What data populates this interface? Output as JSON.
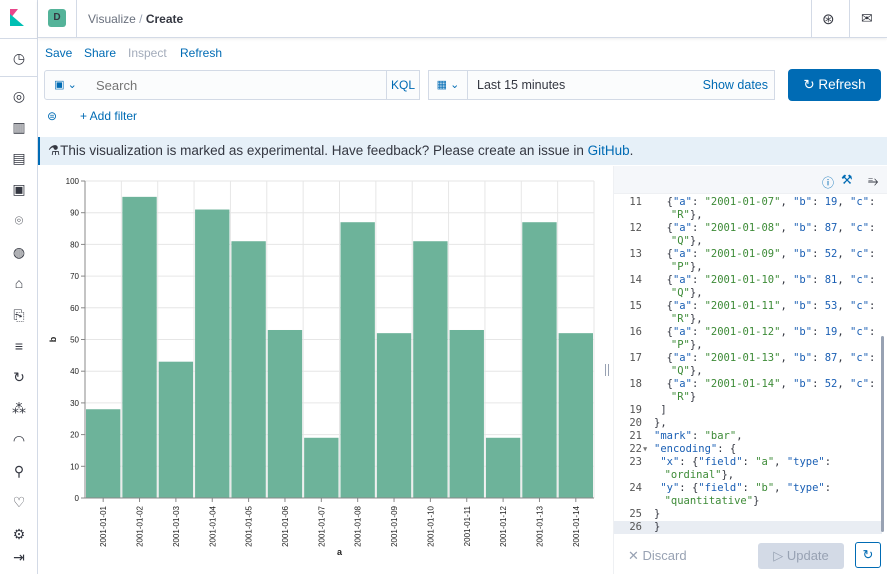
{
  "header": {
    "space_initial": "D",
    "breadcrumb": [
      "Visualize",
      "Create"
    ]
  },
  "menu": {
    "save": "Save",
    "share": "Share",
    "inspect": "Inspect",
    "refresh": "Refresh"
  },
  "query": {
    "placeholder": "Search",
    "language": "KQL",
    "time": "Last 15 minutes",
    "show_dates": "Show dates",
    "refresh_button": "Refresh"
  },
  "filter": {
    "add": "+ Add filter"
  },
  "callout": {
    "text": "This visualization is marked as experimental. Have feedback? Please create an issue in ",
    "link": "GitHub",
    "end": "."
  },
  "colors": {
    "bar": "#6db39a",
    "accent": "#006bb4"
  },
  "chart_data": {
    "type": "bar",
    "categories": [
      "2001-01-01",
      "2001-01-02",
      "2001-01-03",
      "2001-01-04",
      "2001-01-05",
      "2001-01-06",
      "2001-01-07",
      "2001-01-08",
      "2001-01-09",
      "2001-01-10",
      "2001-01-11",
      "2001-01-12",
      "2001-01-13",
      "2001-01-14"
    ],
    "values": [
      28,
      95,
      43,
      91,
      81,
      53,
      19,
      87,
      52,
      81,
      53,
      19,
      87,
      52
    ],
    "xlabel": "a",
    "ylabel": "b",
    "ylim": [
      0,
      100
    ],
    "yticks": [
      0,
      10,
      20,
      30,
      40,
      50,
      60,
      70,
      80,
      90,
      100
    ],
    "grid": true
  },
  "editor": {
    "lines": [
      {
        "n": "11",
        "t": "  {\"a\": \"2001-01-07\", \"b\": 19, \"c\":",
        "w": "    \"R\"},"
      },
      {
        "n": "12",
        "t": "  {\"a\": \"2001-01-08\", \"b\": 87, \"c\":",
        "w": "    \"Q\"},"
      },
      {
        "n": "13",
        "t": "  {\"a\": \"2001-01-09\", \"b\": 52, \"c\":",
        "w": "    \"P\"},"
      },
      {
        "n": "14",
        "t": "  {\"a\": \"2001-01-10\", \"b\": 81, \"c\":",
        "w": "    \"Q\"},"
      },
      {
        "n": "15",
        "t": "  {\"a\": \"2001-01-11\", \"b\": 53, \"c\":",
        "w": "    \"R\"},"
      },
      {
        "n": "16",
        "t": "  {\"a\": \"2001-01-12\", \"b\": 19, \"c\":",
        "w": "    \"P\"},"
      },
      {
        "n": "17",
        "t": "  {\"a\": \"2001-01-13\", \"b\": 87, \"c\":",
        "w": "    \"Q\"},"
      },
      {
        "n": "18",
        "t": "  {\"a\": \"2001-01-14\", \"b\": 52, \"c\":",
        "w": "    \"R\"}"
      },
      {
        "n": "19",
        "t": " ]"
      },
      {
        "n": "20",
        "t": "},"
      },
      {
        "n": "21",
        "t": "\"mark\": \"bar\","
      },
      {
        "n": "22",
        "t": "\"encoding\": {"
      },
      {
        "n": "23",
        "t": " \"x\": {\"field\": \"a\", \"type\":",
        "w": "   \"ordinal\"},"
      },
      {
        "n": "24",
        "t": " \"y\": {\"field\": \"b\", \"type\":",
        "w": "   \"quantitative\"}"
      },
      {
        "n": "25",
        "t": "}"
      },
      {
        "n": "26",
        "t": "}"
      }
    ],
    "discard": "Discard",
    "update": "Update"
  }
}
